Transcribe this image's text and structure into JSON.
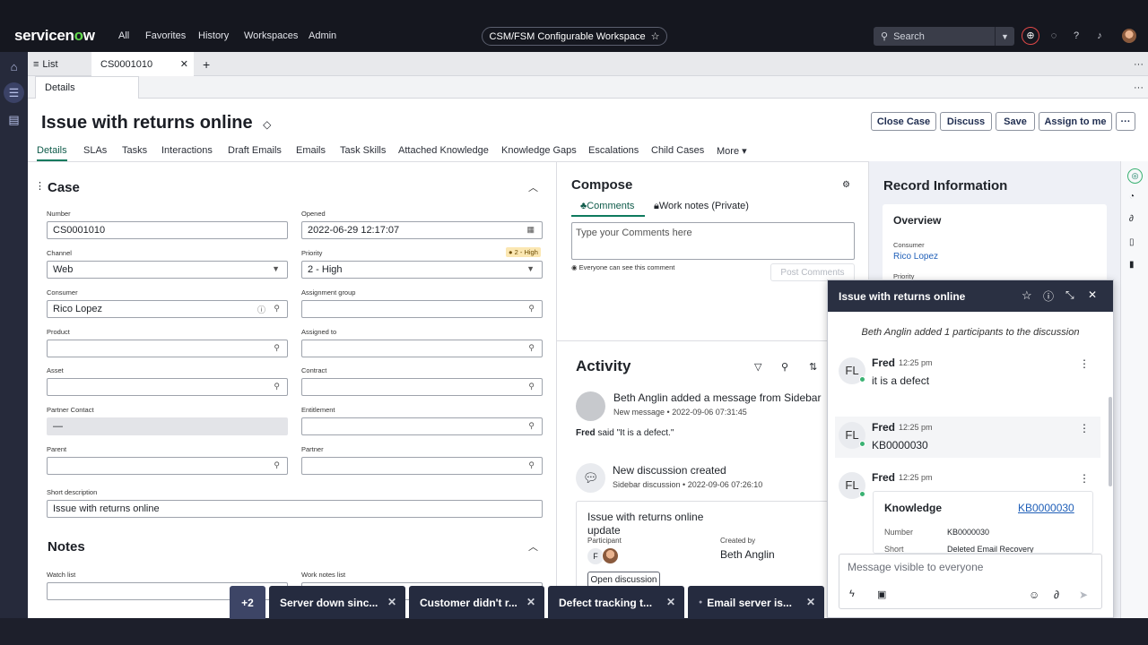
{
  "topbar": {
    "logo": "servicenow",
    "nav": [
      "All",
      "Favorites",
      "History",
      "Workspaces",
      "Admin"
    ],
    "workspace": "CSM/FSM Configurable Workspace",
    "search_placeholder": "Search"
  },
  "tabs": {
    "list_label": "List",
    "record_tab": "CS0001010",
    "sub_tab": "Details"
  },
  "header": {
    "title": "Issue with returns online",
    "buttons": [
      "Close Case",
      "Discuss",
      "Save",
      "Assign to me"
    ],
    "more": "···"
  },
  "form_tabs": [
    "Details",
    "SLAs",
    "Tasks",
    "Interactions",
    "Draft Emails",
    "Emails",
    "Task Skills",
    "Attached Knowledge",
    "Knowledge Gaps",
    "Escalations",
    "Child Cases",
    "More"
  ],
  "case": {
    "section_title": "Case",
    "number_label": "Number",
    "number": "CS0001010",
    "opened_label": "Opened",
    "opened": "2022-06-29 12:17:07",
    "channel_label": "Channel",
    "channel": "Web",
    "priority_label": "Priority",
    "priority": "2 - High",
    "priority_badge": "2 - High",
    "consumer_label": "Consumer",
    "consumer": "Rico Lopez",
    "assignment_group_label": "Assignment group",
    "product_label": "Product",
    "assigned_to_label": "Assigned to",
    "asset_label": "Asset",
    "contract_label": "Contract",
    "partner_contact_label": "Partner Contact",
    "partner_contact": "—",
    "entitlement_label": "Entitlement",
    "parent_label": "Parent",
    "partner_label": "Partner",
    "short_description_label": "Short description",
    "short_description": "Issue with returns online"
  },
  "notes": {
    "section_title": "Notes",
    "watch_list_label": "Watch list",
    "work_notes_list_label": "Work notes list"
  },
  "compose": {
    "title": "Compose",
    "tab_comments": "Comments",
    "tab_work_notes": "Work notes (Private)",
    "placeholder": "Type your Comments here",
    "visibility": "Everyone can see this comment",
    "post_button": "Post Comments"
  },
  "activity": {
    "title": "Activity",
    "item1_title": "Beth Anglin added a message from Sidebar",
    "item1_sub": "New message",
    "item1_time": "2022-09-06 07:31:45",
    "item1_said_name": "Fred",
    "item1_said_verb": "said",
    "item1_quote": "\"It is a defect.\"",
    "item2_title": "New discussion created",
    "item2_sub": "Sidebar discussion",
    "item2_time": "2022-09-06 07:26:10",
    "card_title": "Issue with returns online update",
    "card_participant_label": "Participant",
    "card_participant_initial": "F",
    "card_created_by_label": "Created by",
    "card_created_by": "Beth Anglin",
    "card_button": "Open discussion"
  },
  "record": {
    "title": "Record Information",
    "overview": "Overview",
    "consumer_label": "Consumer",
    "consumer": "Rico Lopez",
    "priority_label": "Priority"
  },
  "chat": {
    "title": "Issue with returns online",
    "system_msg": "Beth Anglin added 1 participants to the discussion",
    "messages": [
      {
        "initials": "FL",
        "name": "Fred",
        "time": "12:25 pm",
        "text": "it is a defect"
      },
      {
        "initials": "FL",
        "name": "Fred",
        "time": "12:25 pm",
        "text": "KB0000030"
      },
      {
        "initials": "FL",
        "name": "Fred",
        "time": "12:25 pm",
        "text": ""
      }
    ],
    "kb_card": {
      "title": "Knowledge",
      "link": "KB0000030",
      "number_label": "Number",
      "number": "KB0000030",
      "short_label": "Short",
      "short_value": "Deleted Email Recovery"
    },
    "input_placeholder": "Message visible to everyone"
  },
  "bottom_tabs": {
    "overflow": "+2",
    "items": [
      "Server down sinc...",
      "Customer didn't r...",
      "Defect tracking t...",
      "Email server is..."
    ]
  },
  "colors": {
    "accent": "#0e7a5e",
    "link": "#1f5fb8",
    "topbar": "#15171f",
    "chat_header": "#2a3042"
  }
}
